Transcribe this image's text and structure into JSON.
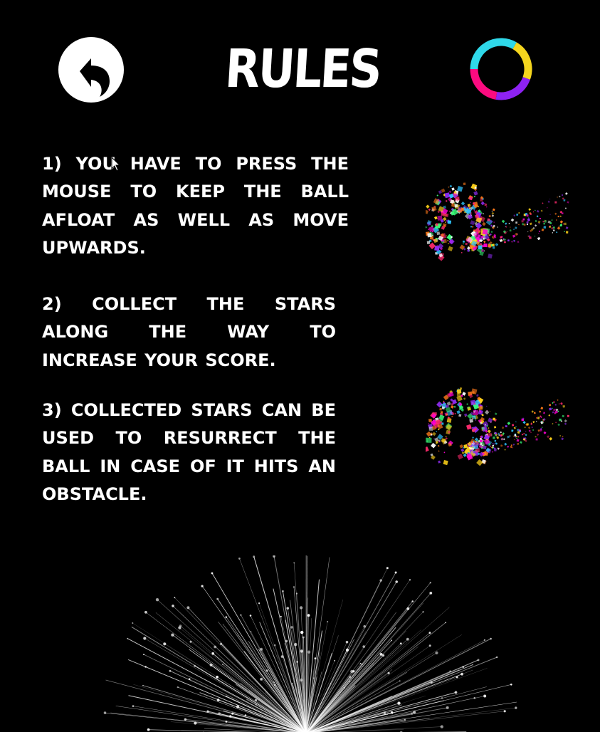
{
  "header": {
    "title": "RULES",
    "back_icon": "undo-arrow-icon",
    "ring_icon": "color-switch-ring-icon"
  },
  "ring_colors": [
    "#f4d51e",
    "#8e22f3",
    "#fb0b80",
    "#2fd8e9"
  ],
  "rules": [
    {
      "text": "1) YOU HAVE TO PRESS THE MOUSE TO KEEP THE BALL AFLOAT AS WELL AS MOVE UPWARDS."
    },
    {
      "text": "2) COLLECT THE STARS ALONG THE WAY TO INCREASE YOUR SCORE."
    },
    {
      "text": "3) COLLECTED STARS CAN BE USED TO RESURRECT THE BALL IN CASE OF IT HITS AN OBSTACLE."
    }
  ],
  "decor": {
    "burst_icon": "particle-burst-icon",
    "firework_icon": "firework-icon"
  }
}
